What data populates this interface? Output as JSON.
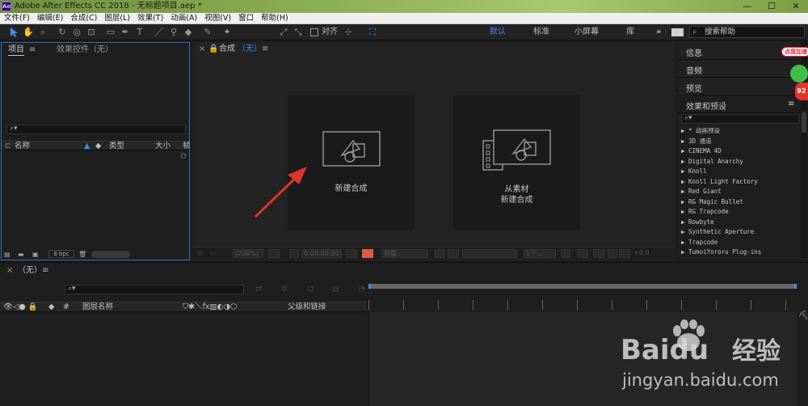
{
  "titlebar": {
    "title": "Adobe After Effects CC 2018 - 无标题项目.aep *",
    "app_icon": "Ae",
    "minimize": "—",
    "maximize": "☐",
    "close": "✕"
  },
  "menu": {
    "items": [
      "文件(F)",
      "编辑(E)",
      "合成(C)",
      "图层(L)",
      "效果(T)",
      "动画(A)",
      "视图(V)",
      "窗口",
      "帮助(H)"
    ]
  },
  "toolbar": {
    "snap_label": "对齐",
    "workspaces": [
      "默认",
      "标准",
      "小屏幕",
      "库"
    ],
    "more": "»",
    "search_placeholder": "搜索帮助",
    "accent": "#3d8ff5"
  },
  "project_panel": {
    "tab_project": "项目",
    "tab_effects": "效果控件（无）",
    "columns": [
      "名称",
      "类型",
      "大小",
      "帧"
    ],
    "bpc": "8 bpc"
  },
  "comp_panel": {
    "close": "×",
    "tab": "合成",
    "tab_value": "（无）",
    "new_comp_label": "新建合成",
    "from_footage_label_1": "从素材",
    "from_footage_label_2": "新建合成",
    "zoom": "(200%)",
    "timecode": "0:00:00:00",
    "quality": "完整",
    "views": "1个...",
    "exposure": "+0.0"
  },
  "right_panel": {
    "sections": [
      "信息",
      "音频",
      "预览",
      "效果和预设"
    ],
    "effects": [
      "▶ * 动画预设",
      "▶ 3D 通道",
      "▶ CINEMA 4D",
      "▶ Digital Anarchy",
      "▶ Knoll",
      "▶ Knoll Light Factory",
      "▶ Red Giant",
      "▶ RG Magic Bullet",
      "▶ RG Trapcode",
      "▶ Rowbyte",
      "▶ Synthetic Aperture",
      "▶ Trapcode",
      "▶ TumoiYororu Plug-ins"
    ],
    "badge_text": "点我加速",
    "badge_num": "92"
  },
  "timeline": {
    "close": "×",
    "tab": "（无）",
    "columns": [
      "图层名称",
      "父级和链接"
    ]
  },
  "watermark": {
    "brand": "Baidu",
    "brand_cn": "经验",
    "url": "jingyan.baidu.com"
  }
}
